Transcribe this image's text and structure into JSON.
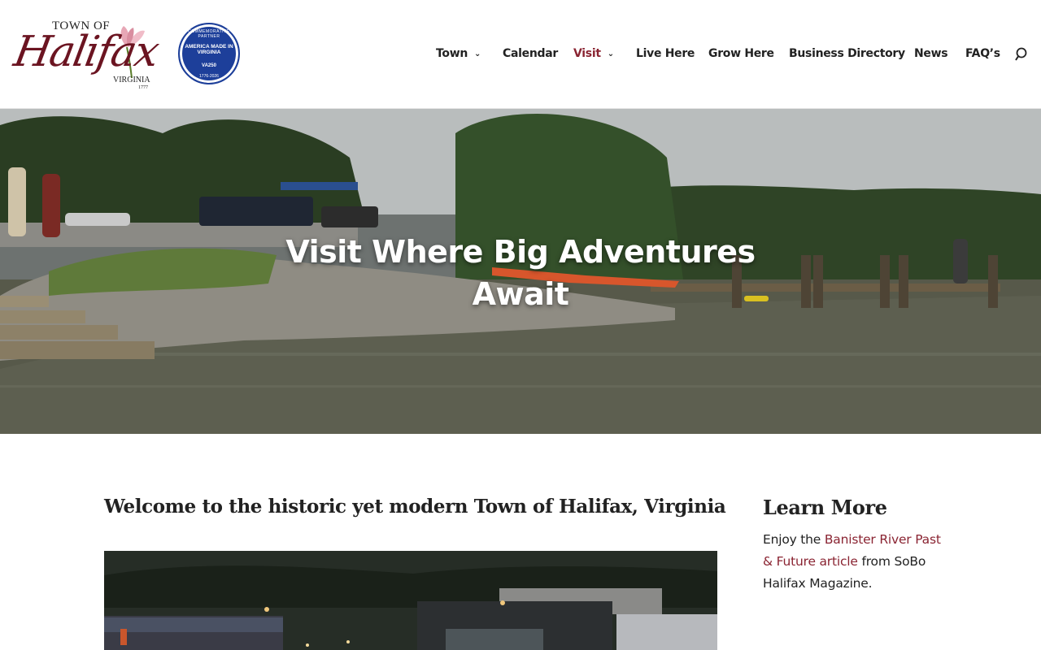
{
  "logo": {
    "top_line": "TOWN OF",
    "script_name": "Halifax",
    "state": "VIRGINIA",
    "year": "1777"
  },
  "seal": {
    "arc_text": "COMMEMORATIVE PARTNER",
    "main_text": "AMERICA MADE IN VIRGINIA",
    "short": "VA250",
    "years": "1776-2026",
    "color": "#1d3f9a"
  },
  "nav": {
    "items": [
      {
        "label": "Town",
        "has_dropdown": true,
        "active": false
      },
      {
        "label": "Calendar",
        "has_dropdown": false,
        "active": false
      },
      {
        "label": "Visit",
        "has_dropdown": true,
        "active": true
      },
      {
        "label": "Live Here",
        "has_dropdown": false,
        "active": false
      },
      {
        "label": "Grow Here",
        "has_dropdown": false,
        "active": false
      },
      {
        "label": "Business Directory",
        "has_dropdown": false,
        "active": false
      },
      {
        "label": "News",
        "has_dropdown": false,
        "active": false
      },
      {
        "label": "FAQ’s",
        "has_dropdown": false,
        "active": false
      }
    ],
    "search_icon": "search-icon",
    "active_color": "#8a2432"
  },
  "hero": {
    "title": "Visit Where Big Adventures Await"
  },
  "main": {
    "heading": "Welcome to the historic yet modern Town of Halifax, Virginia"
  },
  "sidebar": {
    "title": "Learn More",
    "text_before": "Enjoy the ",
    "link_text": "Banister River Past & Future article",
    "text_after": " from SoBo Halifax Magazine."
  }
}
